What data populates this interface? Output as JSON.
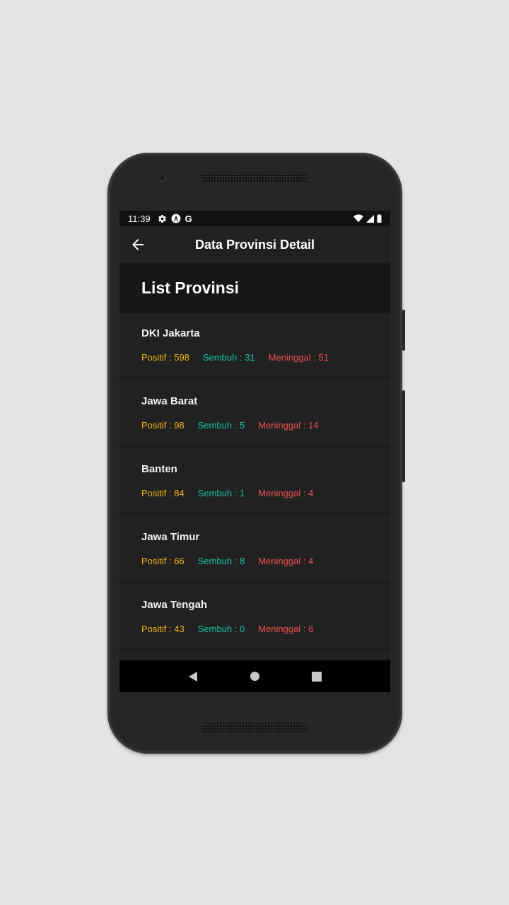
{
  "status_bar": {
    "time": "11:39",
    "left_icons": [
      "gear-icon",
      "android-icon",
      "google-icon"
    ],
    "google_glyph": "G",
    "right_icons": [
      "wifi-icon",
      "signal-icon",
      "battery-icon"
    ]
  },
  "appbar": {
    "title": "Data Provinsi Detail",
    "back_icon": "arrow-left-icon"
  },
  "list": {
    "header": "List Provinsi",
    "items": [
      {
        "name": "DKI Jakarta",
        "positif": "Positif : 598",
        "sembuh": "Sembuh : 31",
        "meninggal": "Meninggal : 51"
      },
      {
        "name": "Jawa Barat",
        "positif": "Positif : 98",
        "sembuh": "Sembuh : 5",
        "meninggal": "Meninggal : 14"
      },
      {
        "name": "Banten",
        "positif": "Positif : 84",
        "sembuh": "Sembuh : 1",
        "meninggal": "Meninggal : 4"
      },
      {
        "name": "Jawa Timur",
        "positif": "Positif : 66",
        "sembuh": "Sembuh : 8",
        "meninggal": "Meninggal : 4"
      },
      {
        "name": "Jawa Tengah",
        "positif": "Positif : 43",
        "sembuh": "Sembuh : 0",
        "meninggal": "Meninggal : 6"
      }
    ]
  },
  "navbar": {
    "buttons": [
      "back-triangle-icon",
      "home-circle-icon",
      "recents-square-icon"
    ]
  },
  "colors": {
    "positif": "#f2b416",
    "sembuh": "#17c2a2",
    "meninggal": "#ee5252",
    "background": "#1c1c1c",
    "card": "#212121"
  }
}
